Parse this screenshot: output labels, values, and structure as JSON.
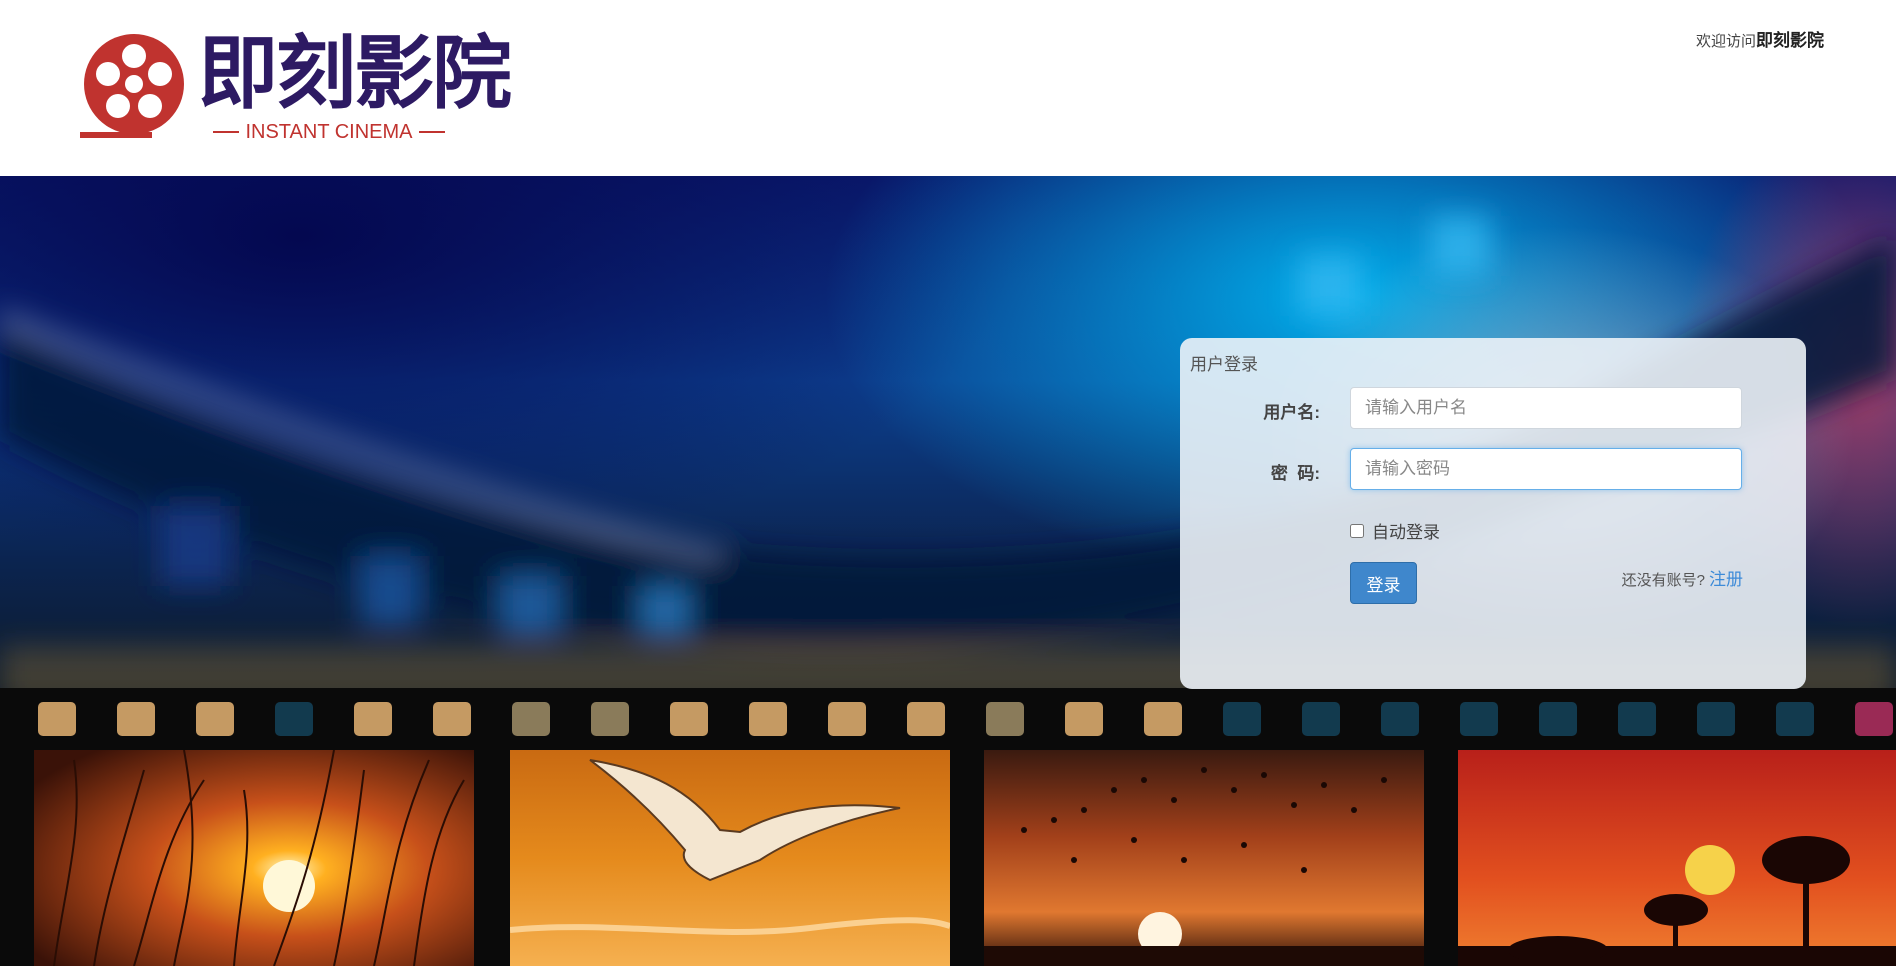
{
  "header": {
    "logo_name": "即刻影院",
    "logo_subtitle": "INSTANT CINEMA",
    "welcome_prefix": "欢迎访问",
    "welcome_site": "即刻影院"
  },
  "login": {
    "title": "用户登录",
    "username_label": "用户名:",
    "username_placeholder": "请输入用户名",
    "password_label": "密  码:",
    "password_placeholder": "请输入密码",
    "auto_login_label": "自动登录",
    "auto_login_checked": false,
    "submit_label": "登录",
    "no_account_text": "还没有账号?",
    "register_link": "注册"
  },
  "theme": {
    "brand_red": "#c0332f",
    "brand_purple": "#2d1a63",
    "button_blue": "#3f87cc",
    "link_blue": "#3d8bd8"
  },
  "background": {
    "film_frames": [
      "sunset-reeds",
      "flying-seagull",
      "birds-at-sunset",
      "savanna-sunset"
    ]
  }
}
